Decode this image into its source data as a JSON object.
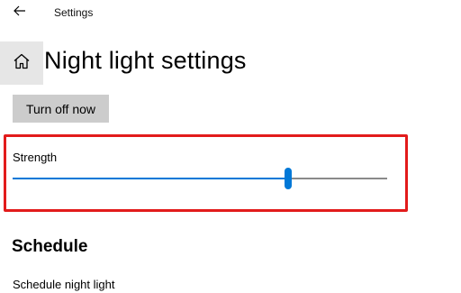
{
  "window": {
    "title": "Settings",
    "back_icon": "arrow-left-icon"
  },
  "header": {
    "home_icon": "home-icon",
    "title": "Night light settings"
  },
  "actions": {
    "turn_off_label": "Turn off now"
  },
  "strength": {
    "label": "Strength",
    "value_fraction": 0.735,
    "accent": "#0078d7",
    "track_color": "#8a8a8a"
  },
  "highlight": {
    "color": "#e21b1b"
  },
  "schedule": {
    "heading": "Schedule",
    "toggle_label": "Schedule night light"
  }
}
